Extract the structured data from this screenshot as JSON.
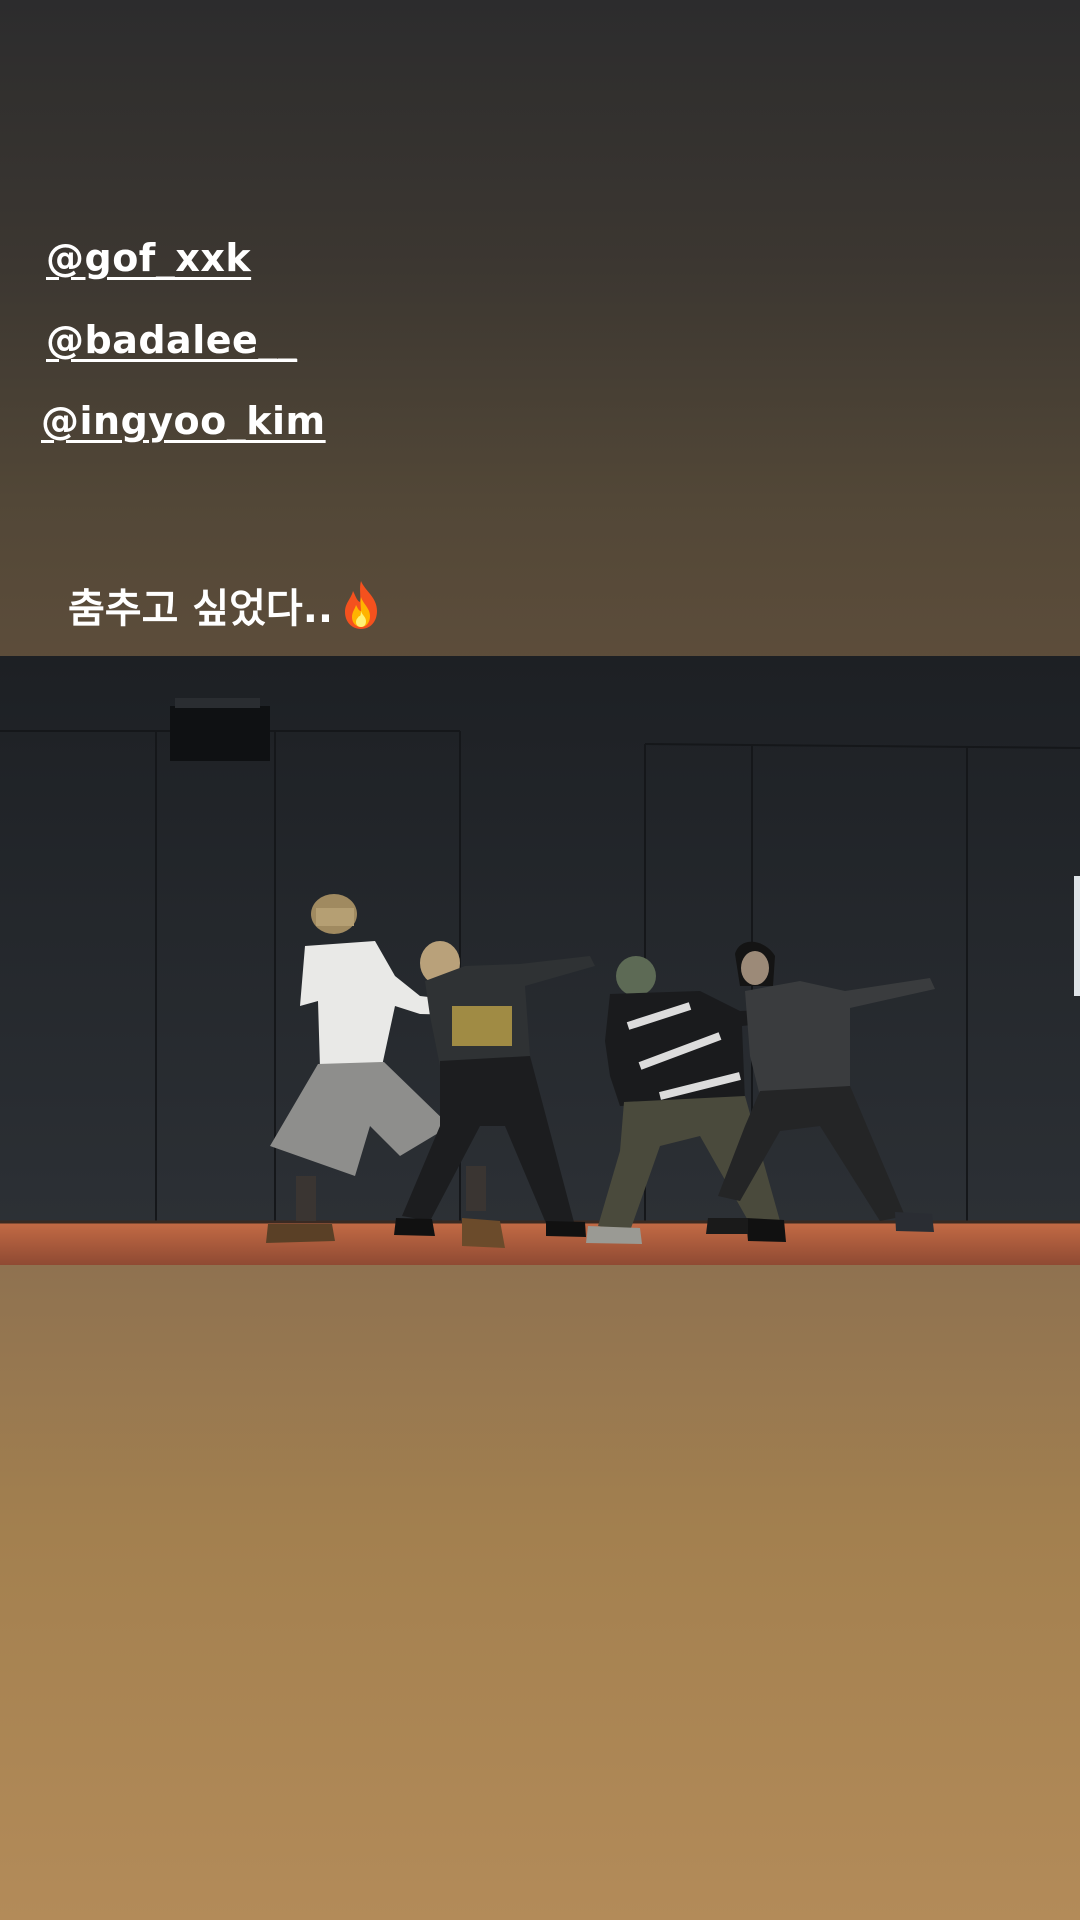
{
  "story": {
    "mentions": [
      "@gof_xxk",
      "@badalee__",
      "@ingyoo_kim"
    ],
    "caption": "춤추고 싶었다..",
    "caption_emoji_icon": "fire-icon",
    "background_gradient": [
      "#2c2c2d",
      "#5b4c3a",
      "#b38b59"
    ],
    "video": {
      "scene": "dance-practice-studio",
      "dancer_count": 4,
      "floor_color": "#a0563a",
      "wall_color": "#25282c"
    }
  }
}
